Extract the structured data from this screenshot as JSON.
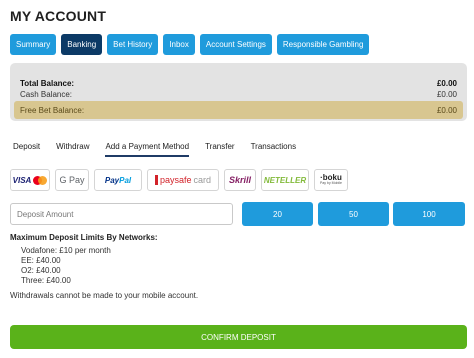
{
  "page": {
    "title": "MY ACCOUNT"
  },
  "tabs": [
    {
      "label": "Summary",
      "active": false
    },
    {
      "label": "Banking",
      "active": true
    },
    {
      "label": "Bet History",
      "active": false
    },
    {
      "label": "Inbox",
      "active": false
    },
    {
      "label": "Account Settings",
      "active": false
    },
    {
      "label": "Responsible Gambling",
      "active": false
    }
  ],
  "balance": {
    "total_label": "Total Balance:",
    "total_value": "£0.00",
    "cash_label": "Cash Balance:",
    "cash_value": "£0.00",
    "free_label": "Free Bet Balance:",
    "free_value": "£0.00"
  },
  "subtabs": [
    {
      "label": "Deposit",
      "active": false
    },
    {
      "label": "Withdraw",
      "active": false
    },
    {
      "label": "Add a Payment Method",
      "active": true
    },
    {
      "label": "Transfer",
      "active": false
    },
    {
      "label": "Transactions",
      "active": false
    }
  ],
  "payment_methods": {
    "visa": "VISA",
    "gpay": "G Pay",
    "paypal_1": "Pay",
    "paypal_2": "Pal",
    "paysafe_1": "paysafe",
    "paysafe_2": "card",
    "skrill": "Skrill",
    "neteller": "NETELLER",
    "boku": "·boku",
    "boku_sub": "Pay by Mobile"
  },
  "deposit": {
    "placeholder": "Deposit Amount",
    "amounts": [
      "20",
      "50",
      "100"
    ]
  },
  "limits": {
    "heading": "Maximum Deposit Limits By Networks:",
    "lines": [
      "Vodafone: £10 per month",
      "EE: £40.00",
      "O2: £40.00",
      "Three: £40.00"
    ]
  },
  "note": "Withdrawals cannot be made to your mobile account.",
  "confirm_label": "CONFIRM DEPOSIT",
  "colors": {
    "accent": "#1f9bdc",
    "active_tab": "#0c3a66",
    "confirm": "#5ab21a",
    "free_bet_row": "#d8c690"
  }
}
